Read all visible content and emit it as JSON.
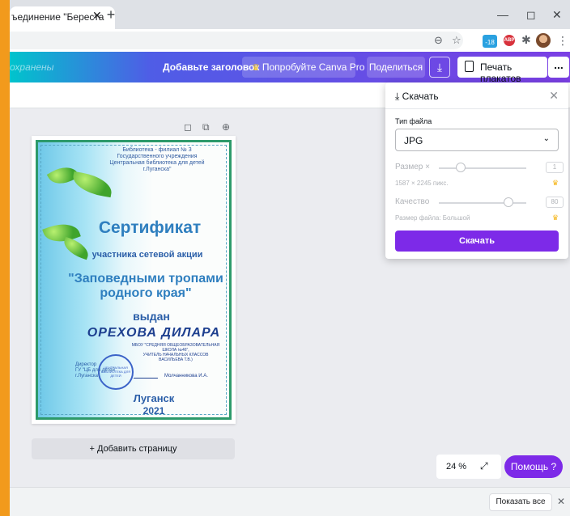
{
  "browser": {
    "tab_title": "ъединение \"Береста",
    "tab_close": "✕",
    "new_tab": "+",
    "window_controls": {
      "minimize": "—",
      "maximize": "◻",
      "close": "✕"
    },
    "address_icons": {
      "zoom": "⊖",
      "star": "☆",
      "puzzle": "✱",
      "menu": "⋮"
    },
    "ext_badge": "-18",
    "abp_label": "ABP"
  },
  "canva_header": {
    "saved_status": "охранены",
    "add_title": "Добавьте заголовок",
    "try_pro": "Попробуйте Canva Pro",
    "share": "Поделиться",
    "download_icon": "⤓",
    "print_posters": "Печать плакатов",
    "more": "..."
  },
  "page_icons": {
    "note": "◻",
    "copy": "⧉",
    "add": "⊕"
  },
  "certificate": {
    "org_line1": "Библиотека - филиал № 3",
    "org_line2": "Государственного учреждения",
    "org_line3": "Центральная библиотека для детей",
    "org_line4": "г.Луганска\"",
    "title": "Сертификат",
    "subtitle": "участника сетевой акции",
    "event_line1": "\"Заповедными тропами",
    "event_line2": "родного края\"",
    "issued": "выдан",
    "name": "ОРЕХОВА ДИЛАРА",
    "school_line1": "МБОУ \"СРЕДНЯЯ ОБЩЕОБРАЗОВАТЕЛЬНАЯ",
    "school_line2": "ШКОЛА №46\",",
    "school_line3": "УЧИТЕЛЬ НАЧАЛЬНЫХ КЛАССОВ",
    "school_line4": "ВАСИЛЬЕВА Т.В.)",
    "director_line1": "Директор",
    "director_line2": "ГУ \"ЦБ для детей",
    "director_line3": "г.Луганска\"",
    "stamp_text": "ЦЕНТРАЛЬНАЯ БИБЛИОТЕКА ДЛЯ ДЕТЕЙ",
    "signer": "Молчанникова И.А.",
    "city": "Луганск",
    "year": "2021"
  },
  "editor": {
    "add_page": "+ Добавить страницу",
    "zoom": "24 %",
    "expand_icon": "⤢",
    "help": "Помощь ?"
  },
  "download_panel": {
    "title": "Скачать",
    "title_icon": "⤓",
    "close": "✕",
    "file_type_label": "Тип файла",
    "file_type_value": "JPG",
    "chevron": "⌄",
    "size_label": "Размер ×",
    "size_value": "1",
    "size_fraction": 0.25,
    "dimensions": "1587 × 2245 пикс.",
    "quality_label": "Качество",
    "quality_value": "80",
    "quality_fraction": 0.8,
    "file_size": "Размер файла: Большой",
    "crown": "♛",
    "download_button": "Скачать"
  },
  "downloads_bar": {
    "show_all": "Показать все",
    "close": "✕"
  },
  "colors": {
    "canva_purple": "#7d2ae8",
    "header_gradient_start": "#00c4cc",
    "header_gradient_end": "#7b3fe4",
    "desktop_orange": "#f29a1c"
  }
}
